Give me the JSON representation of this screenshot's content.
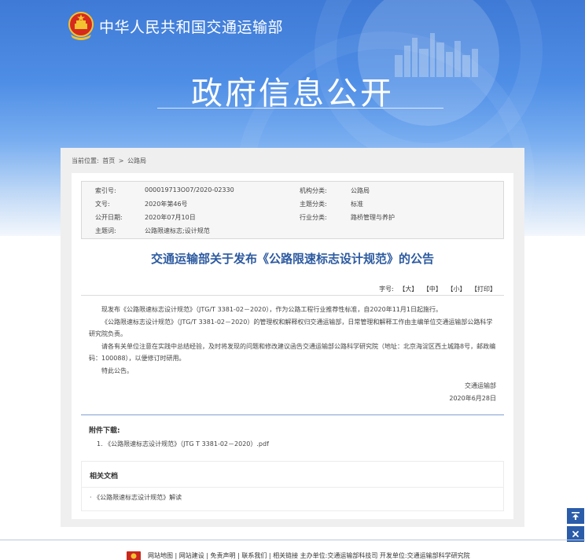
{
  "header": {
    "ministry_name": "中华人民共和国交通运输部",
    "section_title": "政府信息公开",
    "icons": [
      "national-emblem-icon",
      "city-skyline-icon"
    ]
  },
  "breadcrumb": {
    "label": "当前位置:",
    "home": "首页",
    "separator": ">",
    "current": "公路局"
  },
  "meta": {
    "index_label": "索引号:",
    "index_value": "000019713O07/2020-02330",
    "org_label": "机构分类:",
    "org_value": "公路局",
    "docno_label": "文号:",
    "docno_value": "2020年第46号",
    "topic_label": "主题分类:",
    "topic_value": "标准",
    "date_label": "公开日期:",
    "date_value": "2020年07月10日",
    "industry_label": "行业分类:",
    "industry_value": "路桥管理与养护",
    "keyword_label": "主题词:",
    "keyword_value": "公路限速标志;设计规范"
  },
  "document": {
    "title": "交通运输部关于发布《公路限速标志设计规范》的公告",
    "font_label": "字号:",
    "font_large": "【大】",
    "font_medium": "【中】",
    "font_small": "【小】",
    "print": "【打印】",
    "paragraphs": [
      "现发布《公路限速标志设计规范》（JTG/T 3381-02－2020），作为公路工程行业推荐性标准，自2020年11月1日起施行。",
      "《公路限速标志设计规范》（JTG/T 3381-02－2020）的管理权和解释权归交通运输部，日常管理和解释工作由主编单位交通运输部公路科学研究院负责。",
      "请各有关单位注意在实践中总结经验，及时将发现的问题和修改建议函告交通运输部公路科学研究院（地址：北京海淀区西土城路8号，邮政编码：100088），以便修订时研用。",
      "特此公告。"
    ],
    "signature": "交通运输部",
    "sign_date": "2020年6月28日"
  },
  "attachments": {
    "heading": "附件下载:",
    "items": [
      "1. 《公路限速标志设计规范》（JTG T 3381-02－2020）.pdf"
    ]
  },
  "related": {
    "heading": "相关文档",
    "items": [
      "· 《公路限速标志设计规范》解读"
    ]
  },
  "float_buttons": {
    "top": "back-to-top-icon",
    "close": "close-icon"
  },
  "footer": {
    "links": "网站地图 | 网站建设 | 免责声明 | 联系我们 | 相关链接  主办单位:交通运输部科技司  开发单位:交通运输部科学研究院"
  },
  "colors": {
    "banner_blue": "#3e7ad6",
    "title_blue": "#2c5aa0",
    "button_blue": "#2a5caa"
  }
}
